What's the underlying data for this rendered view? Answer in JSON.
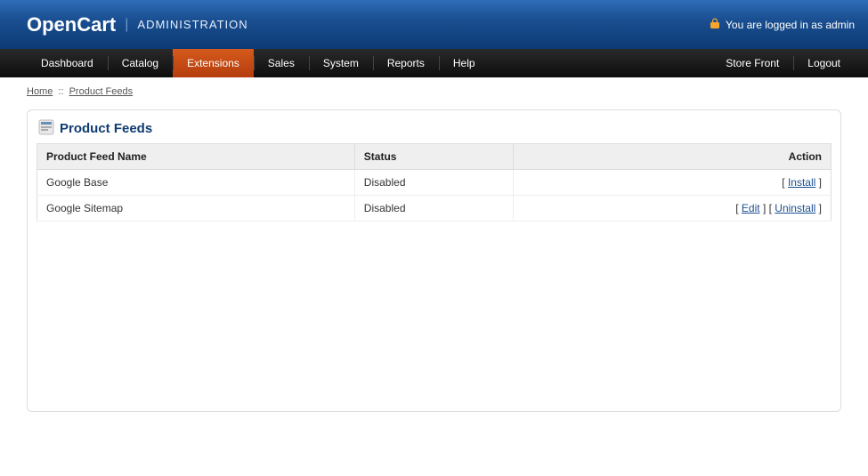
{
  "header": {
    "logo": "OpenCart",
    "admin_label": "ADMINISTRATION",
    "logged_in": "You are logged in as admin"
  },
  "nav": {
    "items": [
      {
        "label": "Dashboard",
        "active": false
      },
      {
        "label": "Catalog",
        "active": false
      },
      {
        "label": "Extensions",
        "active": true
      },
      {
        "label": "Sales",
        "active": false
      },
      {
        "label": "System",
        "active": false
      },
      {
        "label": "Reports",
        "active": false
      },
      {
        "label": "Help",
        "active": false
      }
    ],
    "right": [
      {
        "label": "Store Front"
      },
      {
        "label": "Logout"
      }
    ]
  },
  "breadcrumb": {
    "home": "Home",
    "sep": "::",
    "current": "Product Feeds"
  },
  "page": {
    "title": "Product Feeds",
    "columns": {
      "name": "Product Feed Name",
      "status": "Status",
      "action": "Action"
    },
    "rows": [
      {
        "name": "Google Base",
        "status": "Disabled",
        "actions": [
          {
            "label": "Install"
          }
        ]
      },
      {
        "name": "Google Sitemap",
        "status": "Disabled",
        "actions": [
          {
            "label": "Edit"
          },
          {
            "label": "Uninstall"
          }
        ]
      }
    ]
  }
}
